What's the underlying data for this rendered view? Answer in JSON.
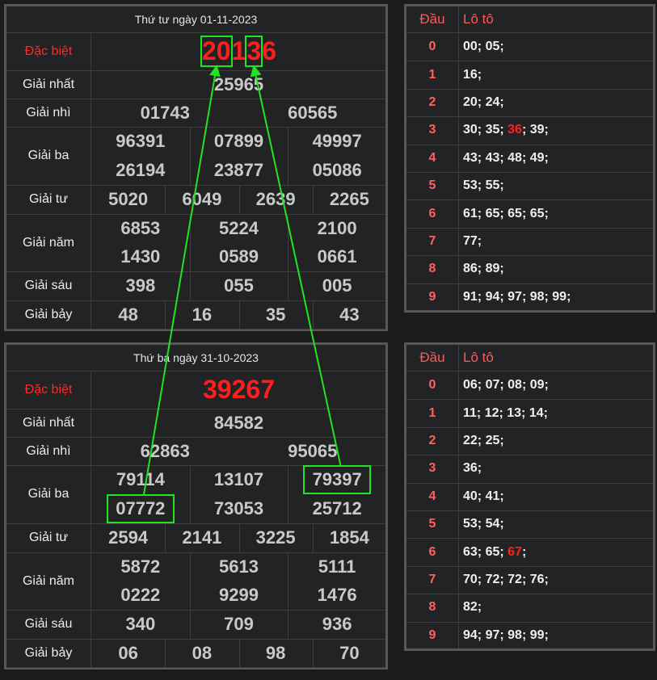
{
  "results": [
    {
      "date_title": "Thứ tư ngày 01-11-2023",
      "labels": {
        "special": "Đặc biệt",
        "first": "Giải nhất",
        "second": "Giải nhì",
        "third": "Giải ba",
        "fourth": "Giải tư",
        "fifth": "Giải năm",
        "sixth": "Giải sáu",
        "seventh": "Giải bảy"
      },
      "special": "20136",
      "first": "25965",
      "second": [
        "01743",
        "60565"
      ],
      "third": [
        "96391",
        "07899",
        "49997",
        "26194",
        "23877",
        "05086"
      ],
      "fourth": [
        "5020",
        "6049",
        "2639",
        "2265"
      ],
      "fifth": [
        "6853",
        "5224",
        "2100",
        "1430",
        "0589",
        "0661"
      ],
      "sixth": [
        "398",
        "055",
        "005"
      ],
      "seventh": [
        "48",
        "16",
        "35",
        "43"
      ]
    },
    {
      "date_title": "Thứ ba ngày 31-10-2023",
      "labels": {
        "special": "Đặc biệt",
        "first": "Giải nhất",
        "second": "Giải nhì",
        "third": "Giải ba",
        "fourth": "Giải tư",
        "fifth": "Giải năm",
        "sixth": "Giải sáu",
        "seventh": "Giải bảy"
      },
      "special": "39267",
      "first": "84582",
      "second": [
        "62863",
        "95065"
      ],
      "third": [
        "79114",
        "13107",
        "79397",
        "07772",
        "73053",
        "25712"
      ],
      "fourth": [
        "2594",
        "2141",
        "3225",
        "1854"
      ],
      "fifth": [
        "5872",
        "5613",
        "5111",
        "0222",
        "9299",
        "1476"
      ],
      "sixth": [
        "340",
        "709",
        "936"
      ],
      "seventh": [
        "06",
        "08",
        "98",
        "70"
      ]
    }
  ],
  "loto_tables": [
    {
      "header_dau": "Đầu",
      "header_loto": "Lô tô",
      "rows": [
        {
          "dau": "0",
          "values": [
            {
              "t": "00; 05;"
            }
          ]
        },
        {
          "dau": "1",
          "values": [
            {
              "t": "16;"
            }
          ]
        },
        {
          "dau": "2",
          "values": [
            {
              "t": "20; 24;"
            }
          ]
        },
        {
          "dau": "3",
          "values": [
            {
              "t": "30; 35; "
            },
            {
              "t": "36",
              "hot": true
            },
            {
              "t": "; 39;"
            }
          ]
        },
        {
          "dau": "4",
          "values": [
            {
              "t": "43; 43; 48; 49;"
            }
          ]
        },
        {
          "dau": "5",
          "values": [
            {
              "t": "53; 55;"
            }
          ]
        },
        {
          "dau": "6",
          "values": [
            {
              "t": "61; 65; 65; 65;"
            }
          ]
        },
        {
          "dau": "7",
          "values": [
            {
              "t": "77;"
            }
          ]
        },
        {
          "dau": "8",
          "values": [
            {
              "t": "86; 89;"
            }
          ]
        },
        {
          "dau": "9",
          "values": [
            {
              "t": "91; 94; 97; 98; 99;"
            }
          ]
        }
      ]
    },
    {
      "header_dau": "Đầu",
      "header_loto": "Lô tô",
      "rows": [
        {
          "dau": "0",
          "values": [
            {
              "t": "06; 07; 08; 09;"
            }
          ]
        },
        {
          "dau": "1",
          "values": [
            {
              "t": "11; 12; 13; 14;"
            }
          ]
        },
        {
          "dau": "2",
          "values": [
            {
              "t": "22; 25;"
            }
          ]
        },
        {
          "dau": "3",
          "values": [
            {
              "t": "36;"
            }
          ]
        },
        {
          "dau": "4",
          "values": [
            {
              "t": "40; 41;"
            }
          ]
        },
        {
          "dau": "5",
          "values": [
            {
              "t": "53; 54;"
            }
          ]
        },
        {
          "dau": "6",
          "values": [
            {
              "t": "63; 65; "
            },
            {
              "t": "67",
              "hot": true
            },
            {
              "t": ";"
            }
          ]
        },
        {
          "dau": "7",
          "values": [
            {
              "t": "70; 72; 72; 76;"
            }
          ]
        },
        {
          "dau": "8",
          "values": [
            {
              "t": "82;"
            }
          ]
        },
        {
          "dau": "9",
          "values": [
            {
              "t": "94; 97; 98; 99;"
            }
          ]
        }
      ]
    }
  ],
  "annotations": {
    "highlight_color": "#22e322",
    "arrows": [
      {
        "from_prize": "third",
        "from_index": 3,
        "to_special_digits": "20"
      },
      {
        "from_prize": "third",
        "from_index": 2,
        "to_special_digits": "3"
      }
    ]
  }
}
